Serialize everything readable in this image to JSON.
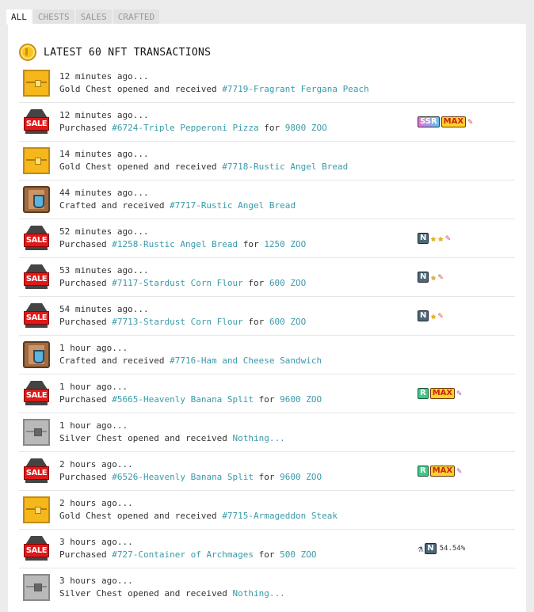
{
  "tabs": [
    {
      "label": "ALL",
      "active": true
    },
    {
      "label": "CHESTS",
      "active": false
    },
    {
      "label": "SALES",
      "active": false
    },
    {
      "label": "CRAFTED",
      "active": false
    }
  ],
  "panel": {
    "title": "LATEST 60 NFT TRANSACTIONS",
    "icon": "gold-coin-icon"
  },
  "rows": [
    {
      "icon": "gold-chest-icon",
      "time": "12 minutes ago...",
      "desc": "Gold Chest opened and received ",
      "link": "#7719-Fragrant Fergana Peach",
      "suffix": "",
      "price": "",
      "badges": []
    },
    {
      "icon": "sale-icon",
      "time": "12 minutes ago...",
      "desc": "Purchased ",
      "link": "#6724-Triple Pepperoni Pizza",
      "suffix": " for ",
      "price": "9800 ZOO",
      "badges": [
        "SSR",
        "MAX",
        "tool-icon"
      ]
    },
    {
      "icon": "gold-chest-icon",
      "time": "14 minutes ago...",
      "desc": "Gold Chest opened and received ",
      "link": "#7718-Rustic Angel Bread",
      "suffix": "",
      "price": "",
      "badges": []
    },
    {
      "icon": "crafted-icon",
      "time": "44 minutes ago...",
      "desc": "Crafted and received ",
      "link": "#7717-Rustic Angel Bread",
      "suffix": "",
      "price": "",
      "badges": []
    },
    {
      "icon": "sale-icon",
      "time": "52 minutes ago...",
      "desc": "Purchased ",
      "link": "#1258-Rustic Angel Bread",
      "suffix": " for ",
      "price": "1250 ZOO",
      "badges": [
        "N",
        "star",
        "star",
        "tool-icon"
      ]
    },
    {
      "icon": "sale-icon",
      "time": "53 minutes ago...",
      "desc": "Purchased ",
      "link": "#7117-Stardust Corn Flour",
      "suffix": " for ",
      "price": "600 ZOO",
      "badges": [
        "N",
        "star",
        "tool-icon"
      ]
    },
    {
      "icon": "sale-icon",
      "time": "54 minutes ago...",
      "desc": "Purchased ",
      "link": "#7713-Stardust Corn Flour",
      "suffix": " for ",
      "price": "600 ZOO",
      "badges": [
        "N",
        "star",
        "tool-icon"
      ]
    },
    {
      "icon": "crafted-icon",
      "time": "1 hour ago...",
      "desc": "Crafted and received ",
      "link": "#7716-Ham and Cheese Sandwich",
      "suffix": "",
      "price": "",
      "badges": []
    },
    {
      "icon": "sale-icon",
      "time": "1 hour ago...",
      "desc": "Purchased ",
      "link": "#5665-Heavenly Banana Split",
      "suffix": " for ",
      "price": "9600 ZOO",
      "badges": [
        "R",
        "MAX",
        "candy-icon"
      ]
    },
    {
      "icon": "silver-chest-icon",
      "time": "1 hour ago...",
      "desc": "Silver Chest opened and received ",
      "link": "Nothing...",
      "suffix": "",
      "price": "",
      "badges": []
    },
    {
      "icon": "sale-icon",
      "time": "2 hours ago...",
      "desc": "Purchased ",
      "link": "#6526-Heavenly Banana Split",
      "suffix": " for ",
      "price": "9600 ZOO",
      "badges": [
        "R",
        "MAX",
        "candy-icon"
      ]
    },
    {
      "icon": "gold-chest-icon",
      "time": "2 hours ago...",
      "desc": "Gold Chest opened and received ",
      "link": "#7715-Armageddon Steak",
      "suffix": "",
      "price": "",
      "badges": []
    },
    {
      "icon": "sale-icon",
      "time": "3 hours ago...",
      "desc": "Purchased ",
      "link": "#727-Container of Archmages",
      "suffix": " for ",
      "price": "500 ZOO",
      "badges": [
        "flask-icon",
        "N",
        "54.54%"
      ]
    },
    {
      "icon": "silver-chest-icon",
      "time": "3 hours ago...",
      "desc": "Silver Chest opened and received ",
      "link": "Nothing...",
      "suffix": "",
      "price": "",
      "badges": []
    }
  ]
}
